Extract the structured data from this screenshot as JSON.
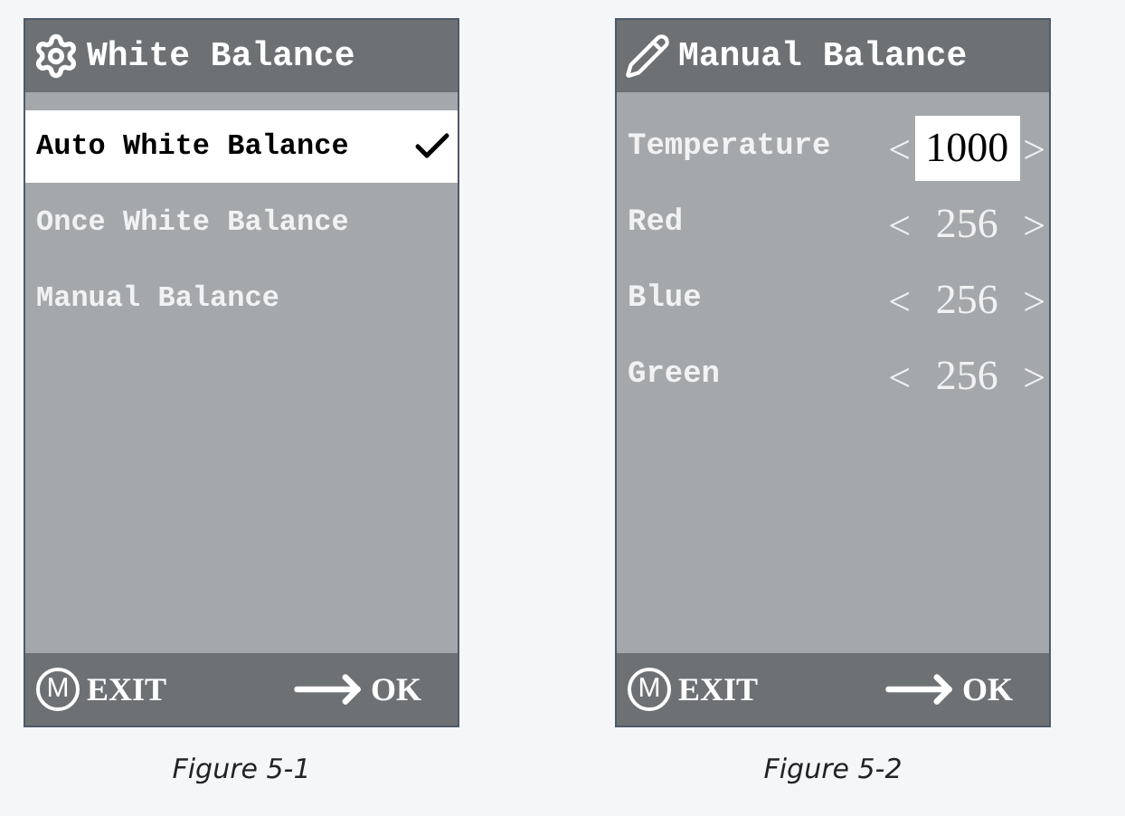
{
  "figures": [
    {
      "title": "White Balance",
      "kind": "menu",
      "items": [
        {
          "label": "Auto White Balance",
          "selected": true,
          "checked": true
        },
        {
          "label": "Once White Balance",
          "selected": false,
          "checked": false
        },
        {
          "label": "Manual Balance",
          "selected": false,
          "checked": false
        }
      ],
      "footer": {
        "exit_key": "M",
        "exit": "EXIT",
        "ok": "OK"
      },
      "caption": "Figure 5-1"
    },
    {
      "title": "Manual Balance",
      "kind": "values",
      "items": [
        {
          "label": "Temperature",
          "left": "<",
          "value": "1000",
          "right": ">",
          "selected": true
        },
        {
          "label": "Red",
          "left": "<",
          "value": "256",
          "right": ">",
          "selected": false
        },
        {
          "label": "Blue",
          "left": "<",
          "value": "256",
          "right": ">",
          "selected": false
        },
        {
          "label": "Green",
          "left": "<",
          "value": "256",
          "right": ">",
          "selected": false
        }
      ],
      "footer": {
        "exit_key": "M",
        "exit": "EXIT",
        "ok": "OK"
      },
      "caption": "Figure 5-2"
    }
  ]
}
